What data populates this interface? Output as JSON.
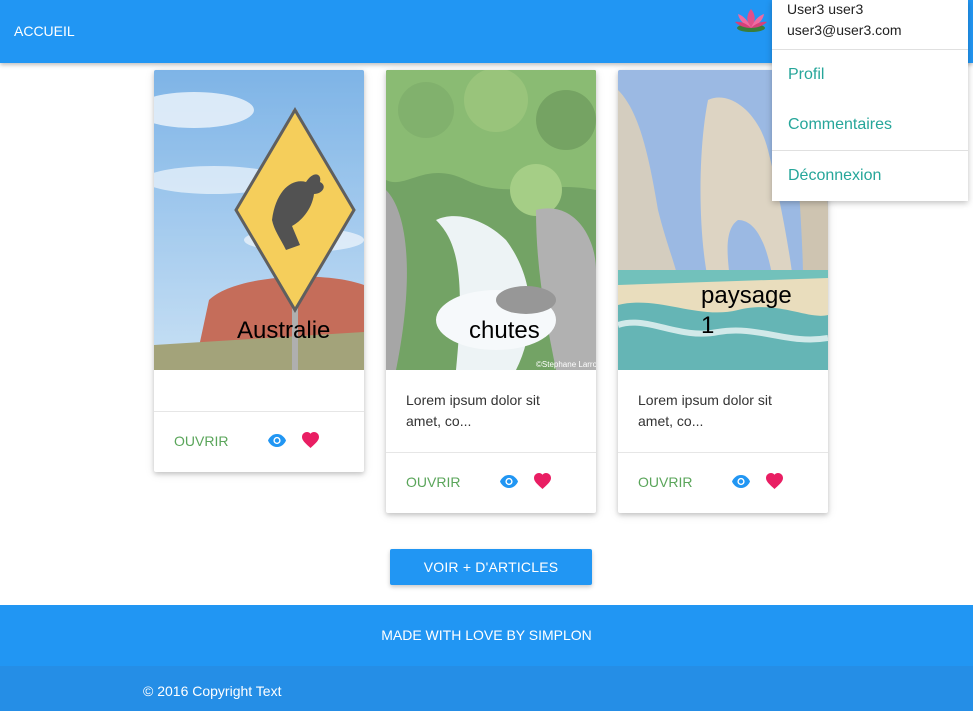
{
  "navbar": {
    "home_label": "ACCUEIL",
    "avatar_icon": "lotus-icon",
    "bg_color": "#2196f3"
  },
  "user_menu": {
    "name": "User3 user3",
    "email": "user3@user3.com",
    "items": [
      {
        "label": "Profil"
      },
      {
        "label": "Commentaires"
      },
      {
        "label": "Déconnexion"
      }
    ],
    "item_color": "#26a69a"
  },
  "cards": [
    {
      "title": "Australie",
      "excerpt": "",
      "open_label": "OUVRIR",
      "image": "kangaroo-sign-uluru"
    },
    {
      "title": "chutes",
      "excerpt": "Lorem ipsum dolor sit amet, co...",
      "open_label": "OUVRIR",
      "image": "waterfall-forest",
      "image_watermark": "©Stephane Larroque"
    },
    {
      "title": "paysage 1",
      "excerpt": "Lorem ipsum dolor sit amet, co...",
      "open_label": "OUVRIR",
      "image": "sea-arch-beach"
    }
  ],
  "card_icons": {
    "view": "eye-icon",
    "like": "heart-icon",
    "view_color": "#2196f3",
    "like_color": "#e91e63",
    "open_color": "#5aa55a"
  },
  "more_button": {
    "label": "VOIR + D'ARTICLES"
  },
  "footer": {
    "tagline": "MADE WITH LOVE BY SIMPLON",
    "copyright": "© 2016 Copyright Text"
  }
}
